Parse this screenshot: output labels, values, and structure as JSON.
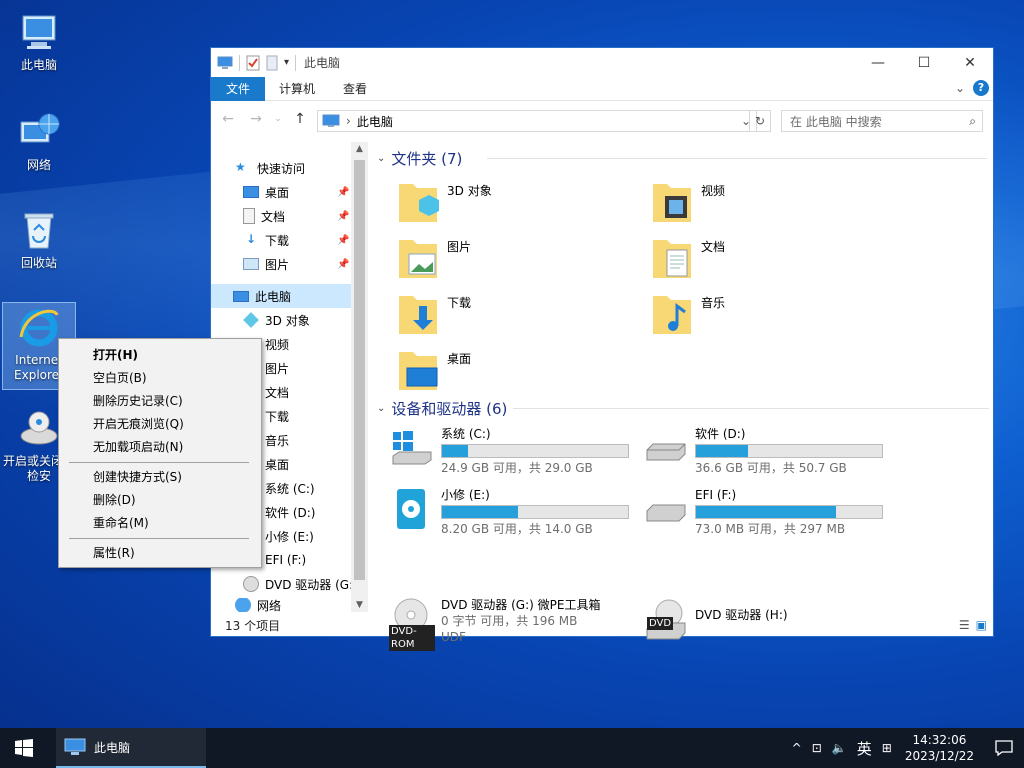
{
  "desktop": {
    "icons": [
      {
        "label": "此电脑"
      },
      {
        "label": "网络"
      },
      {
        "label": "回收站"
      },
      {
        "label": "Internet Explorer"
      },
      {
        "label": "开启或关闭自检安"
      }
    ]
  },
  "window": {
    "title": "此电脑",
    "ribbon_tabs": [
      "文件",
      "计算机",
      "查看"
    ],
    "address_path": "此电脑",
    "search_placeholder": "在 此电脑 中搜索",
    "nav": {
      "quick_access": "快速访问",
      "quick_items": [
        "桌面",
        "文档",
        "下载",
        "图片"
      ],
      "this_pc": "此电脑",
      "pc_items": [
        "3D 对象",
        "视频",
        "图片",
        "文档",
        "下载",
        "音乐",
        "桌面",
        "系统 (C:)",
        "软件 (D:)",
        "小修 (E:)",
        "EFI (F:)",
        "DVD 驱动器 (G:"
      ],
      "network": "网络"
    },
    "folders_header": "文件夹 (7)",
    "folders": [
      "3D 对象",
      "视频",
      "图片",
      "文档",
      "下载",
      "音乐",
      "桌面"
    ],
    "devices_header": "设备和驱动器 (6)",
    "drives": [
      {
        "name": "系统 (C:)",
        "info": "24.9 GB 可用，共 29.0 GB",
        "used": 0.14
      },
      {
        "name": "软件 (D:)",
        "info": "36.6 GB 可用，共 50.7 GB",
        "used": 0.28
      },
      {
        "name": "小修 (E:)",
        "info": "8.20 GB 可用，共 14.0 GB",
        "used": 0.41
      },
      {
        "name": "EFI (F:)",
        "info": "73.0 MB 可用，共 297 MB",
        "used": 0.75
      },
      {
        "name": "DVD 驱动器 (G:) 微PE工具箱",
        "info": "0 字节 可用，共 196 MB",
        "extra": "UDF",
        "badge": "DVD-ROM"
      },
      {
        "name": "DVD 驱动器 (H:)",
        "badge": "DVD"
      }
    ],
    "status": "13 个项目"
  },
  "context_menu": {
    "items": [
      "打开(H)",
      "空白页(B)",
      "删除历史记录(C)",
      "开启无痕浏览(Q)",
      "无加载项启动(N)",
      "创建快捷方式(S)",
      "删除(D)",
      "重命名(M)",
      "属性(R)"
    ]
  },
  "taskbar": {
    "app_label": "此电脑",
    "ime_lang": "英",
    "time": "14:32:06",
    "date": "2023/12/22"
  },
  "colors": {
    "accent": "#1979ca",
    "drive_bar": "#26a0da",
    "taskbar": "#101725"
  }
}
